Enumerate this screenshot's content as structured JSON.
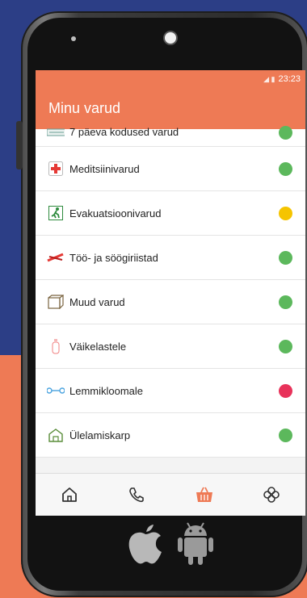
{
  "status": {
    "time": "23:23"
  },
  "app": {
    "title": "Minu varud"
  },
  "items": [
    {
      "label": "7 päeva kodused varud",
      "icon": "house-stock-icon",
      "status": "green"
    },
    {
      "label": "Meditsiinivarud",
      "icon": "medical-cross-icon",
      "status": "green"
    },
    {
      "label": "Evakuatsioonivarud",
      "icon": "evacuation-exit-icon",
      "status": "yellow"
    },
    {
      "label": "Töö- ja söögiriistad",
      "icon": "tools-cutlery-icon",
      "status": "green"
    },
    {
      "label": "Muud varud",
      "icon": "box-icon",
      "status": "green"
    },
    {
      "label": "Väikelastele",
      "icon": "baby-bottle-icon",
      "status": "green"
    },
    {
      "label": "Lemmikloomale",
      "icon": "pet-bone-icon",
      "status": "red"
    },
    {
      "label": "Ülelamiskarp",
      "icon": "survival-kit-icon",
      "status": "green"
    }
  ],
  "colors": {
    "accent": "#ee7a55",
    "green": "#5cb85c",
    "yellow": "#f5c400",
    "red": "#e8325a",
    "background_top": "#2c3e86"
  },
  "nav": [
    {
      "icon": "home-icon"
    },
    {
      "icon": "phone-icon"
    },
    {
      "icon": "basket-icon",
      "active": true
    },
    {
      "icon": "clover-icon"
    }
  ],
  "os_logos": [
    "apple-logo-icon",
    "android-logo-icon"
  ]
}
